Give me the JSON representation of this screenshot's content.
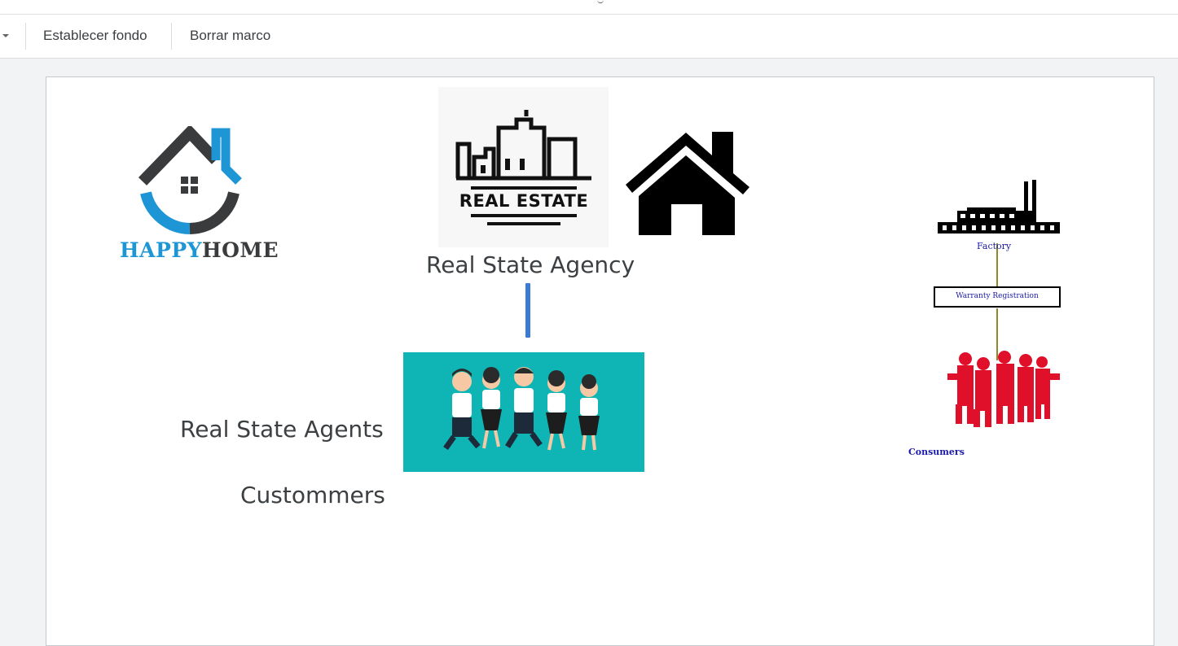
{
  "toolbar": {
    "set_background_label": "Establecer fondo",
    "clear_frame_label": "Borrar marco"
  },
  "slide": {
    "logo_text_part1": "HAPPY",
    "logo_text_part2": "HOME",
    "real_estate_logo_text": "REAL ESTATE",
    "title_agency": "Real State Agency",
    "label_agents": "Real State Agents",
    "label_customers": "Custommers",
    "diagram": {
      "factory_label": "Factory",
      "registration_label": "Warranty Registration",
      "consumers_label": "Consumers"
    }
  },
  "colors": {
    "brand_blue": "#1e96d6",
    "brand_dark": "#3a3b3d",
    "teal_bg": "#0fb5b5",
    "connector_blue": "#3b7bd8",
    "diagram_text": "#1a1aa8",
    "consumers_red": "#e0102a"
  },
  "icons": [
    "caret-down-icon",
    "house-icon",
    "skyline-icon",
    "factory-icon"
  ]
}
